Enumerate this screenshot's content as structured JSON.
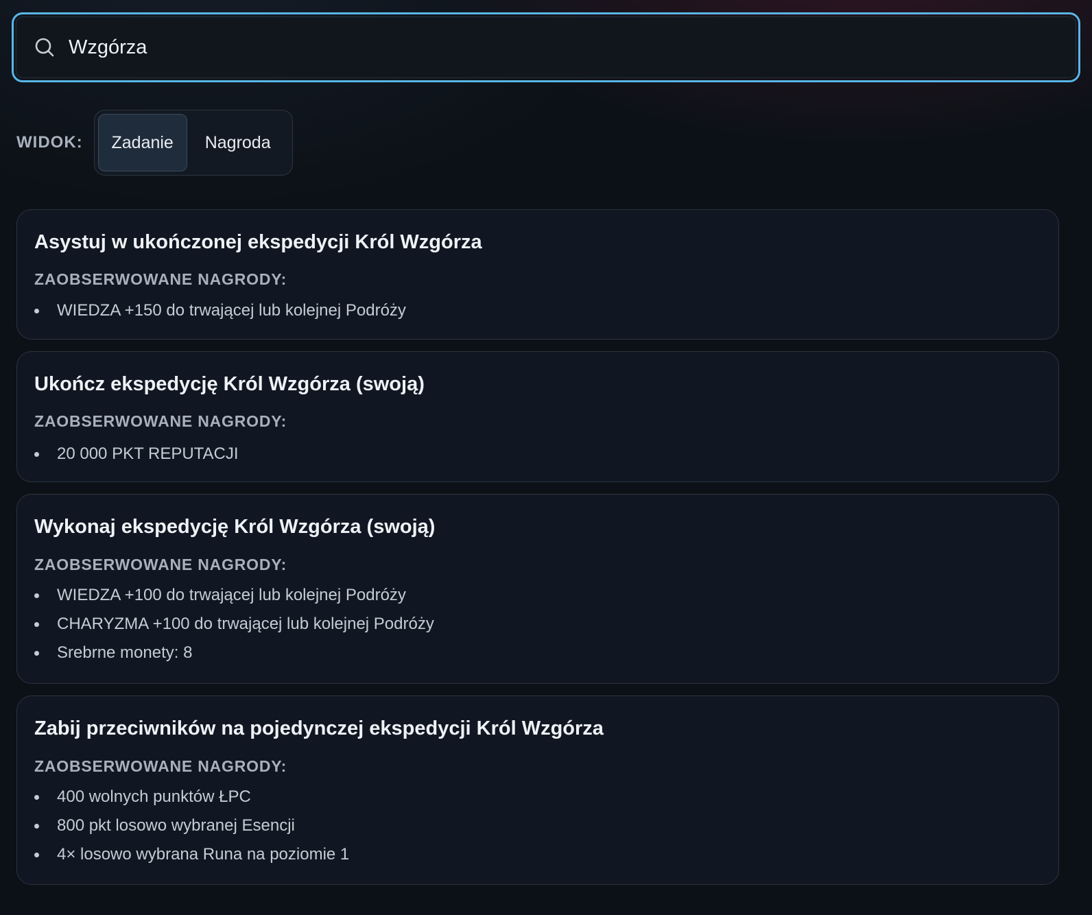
{
  "search": {
    "value": "Wzgórza",
    "icon": "search-icon"
  },
  "view": {
    "label": "WIDOK:",
    "options": [
      "Zadanie",
      "Nagroda"
    ],
    "selected": "Zadanie"
  },
  "rewards_label": "ZAOBSERWOWANE NAGRODY:",
  "cards": [
    {
      "title": "Asystuj w ukończonej ekspedycji Król Wzgórza",
      "rewards": [
        "WIEDZA +150 do trwającej lub kolejnej Podróży"
      ]
    },
    {
      "title": "Ukończ ekspedycję Król Wzgórza (swoją)",
      "rewards": [
        "20 000 PKT REPUTACJI"
      ]
    },
    {
      "title": "Wykonaj ekspedycję Król Wzgórza (swoją)",
      "rewards": [
        "WIEDZA +100 do trwającej lub kolejnej Podróży",
        "CHARYZMA +100 do trwającej lub kolejnej Podróży",
        "Srebrne monety: 8"
      ]
    },
    {
      "title": "Zabij przeciwników na pojedynczej ekspedycji Król Wzgórza",
      "rewards": [
        "400 wolnych punktów ŁPC",
        "800 pkt losowo wybranej Esencji",
        "4× losowo wybrana Runa na poziomie 1"
      ]
    }
  ]
}
